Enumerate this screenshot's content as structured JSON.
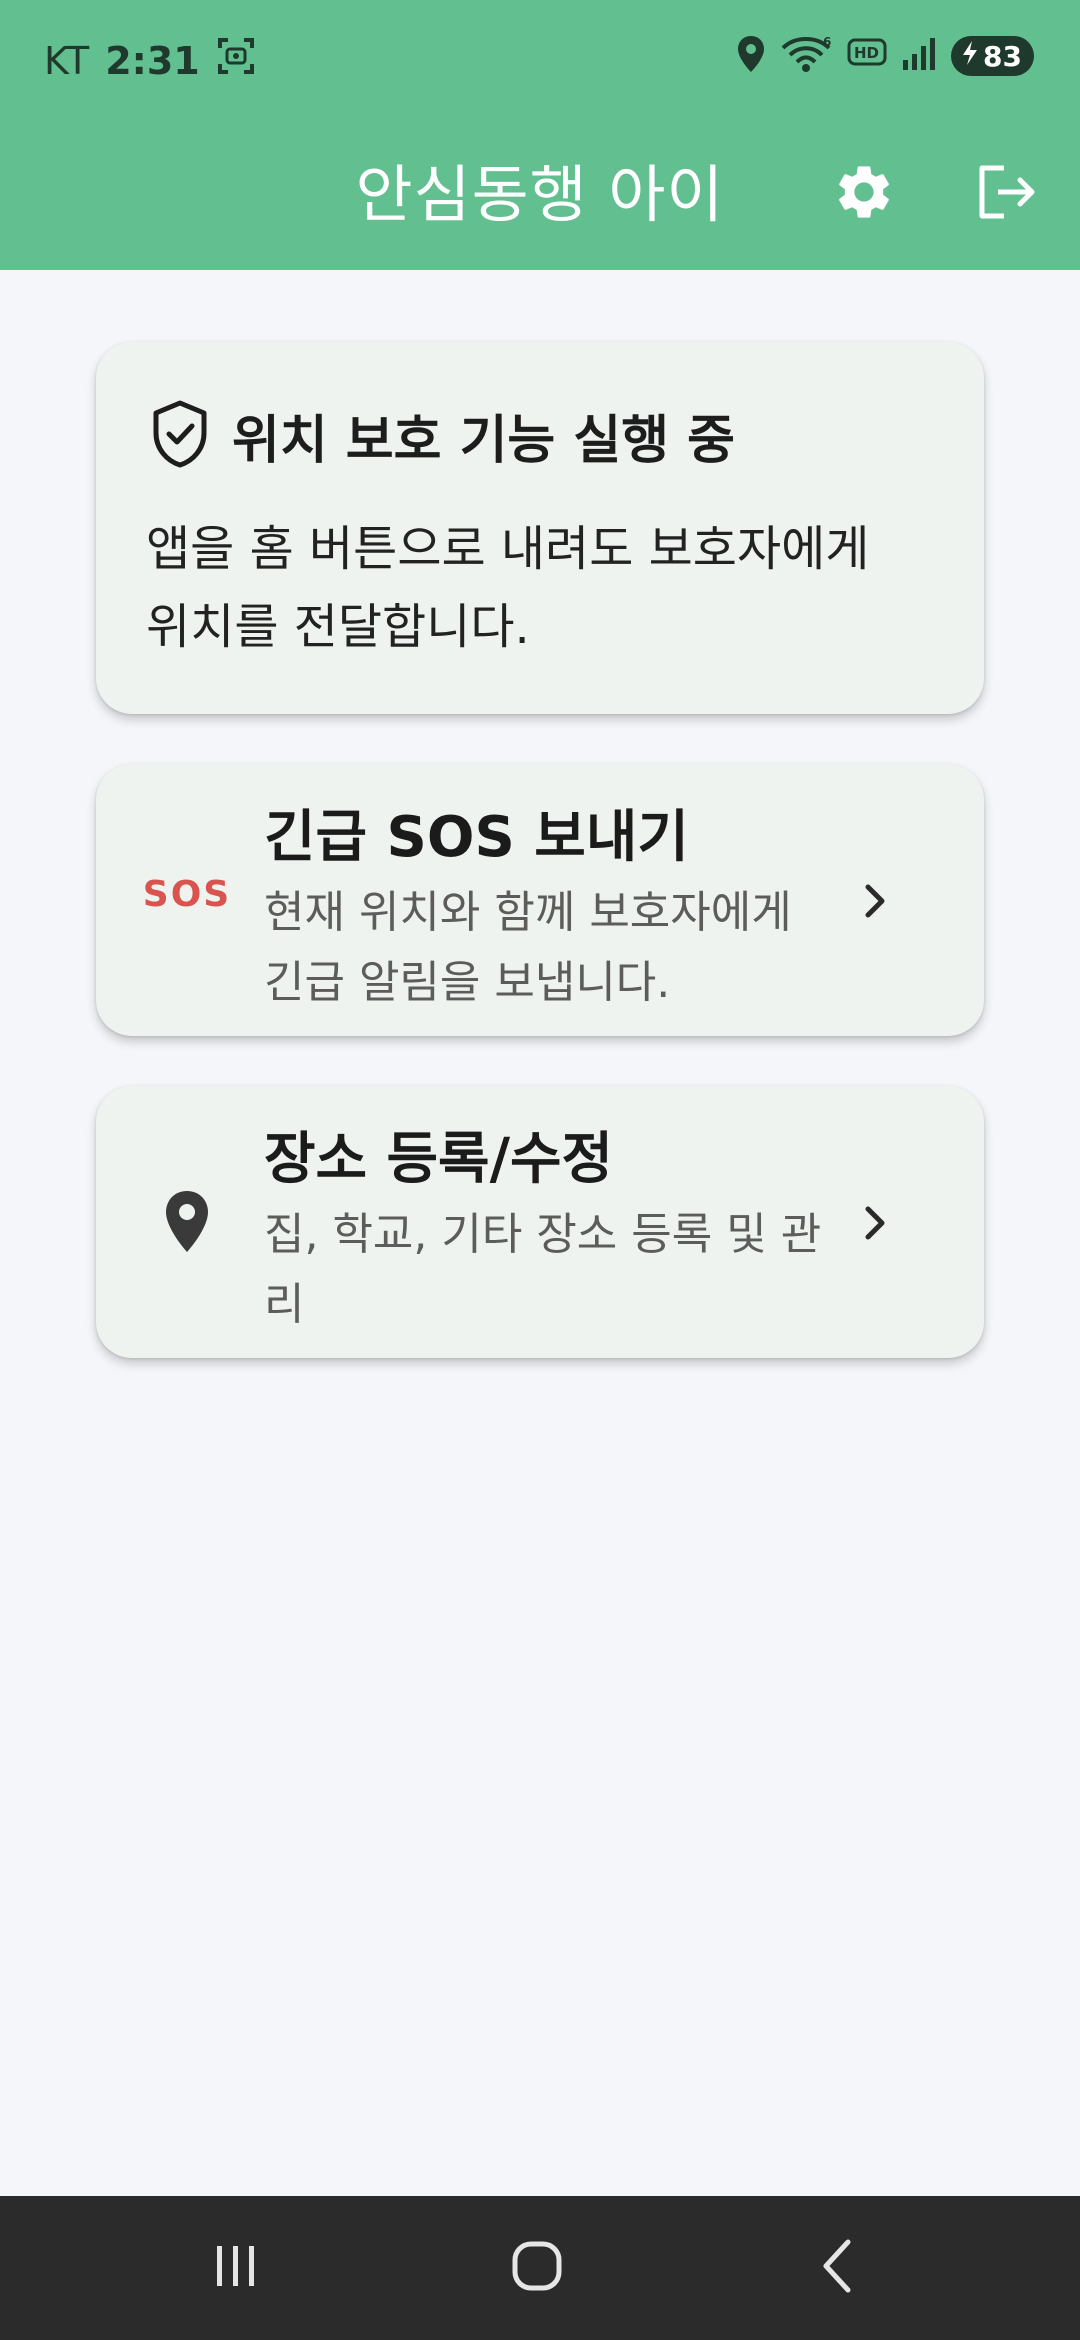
{
  "status_bar": {
    "carrier": "KT",
    "time": "2:31",
    "battery": "83",
    "icons": [
      "screenshot-icon",
      "location-icon",
      "wifi-icon",
      "hd-icon",
      "signal-icon",
      "battery-icon"
    ]
  },
  "app_bar": {
    "title": "안심동행 아이",
    "actions": [
      "gear-icon",
      "logout-icon"
    ]
  },
  "protection_card": {
    "title": "위치 보호 기능 실행 중",
    "body": "앱을 홈 버튼으로 내려도 보호자에게 위치를 전달합니다.",
    "icon": "shield-check-icon"
  },
  "sos_card": {
    "icon_text": "SOS",
    "title": "긴급 SOS 보내기",
    "description": "현재 위치와 함께 보호자에게 긴급 알림을 보냅니다."
  },
  "place_card": {
    "icon": "map-pin-icon",
    "title": "장소 등록/수정",
    "description": "집, 학교, 기타 장소 등록 및 관리"
  },
  "nav_bar": {
    "buttons": [
      "recents-icon",
      "home-icon",
      "back-icon"
    ]
  },
  "colors": {
    "primary": "#62bf8f",
    "background": "#f4f6fa",
    "card": "#eff3f0",
    "sos": "#d9534f",
    "navbar": "#2b2b2b"
  }
}
